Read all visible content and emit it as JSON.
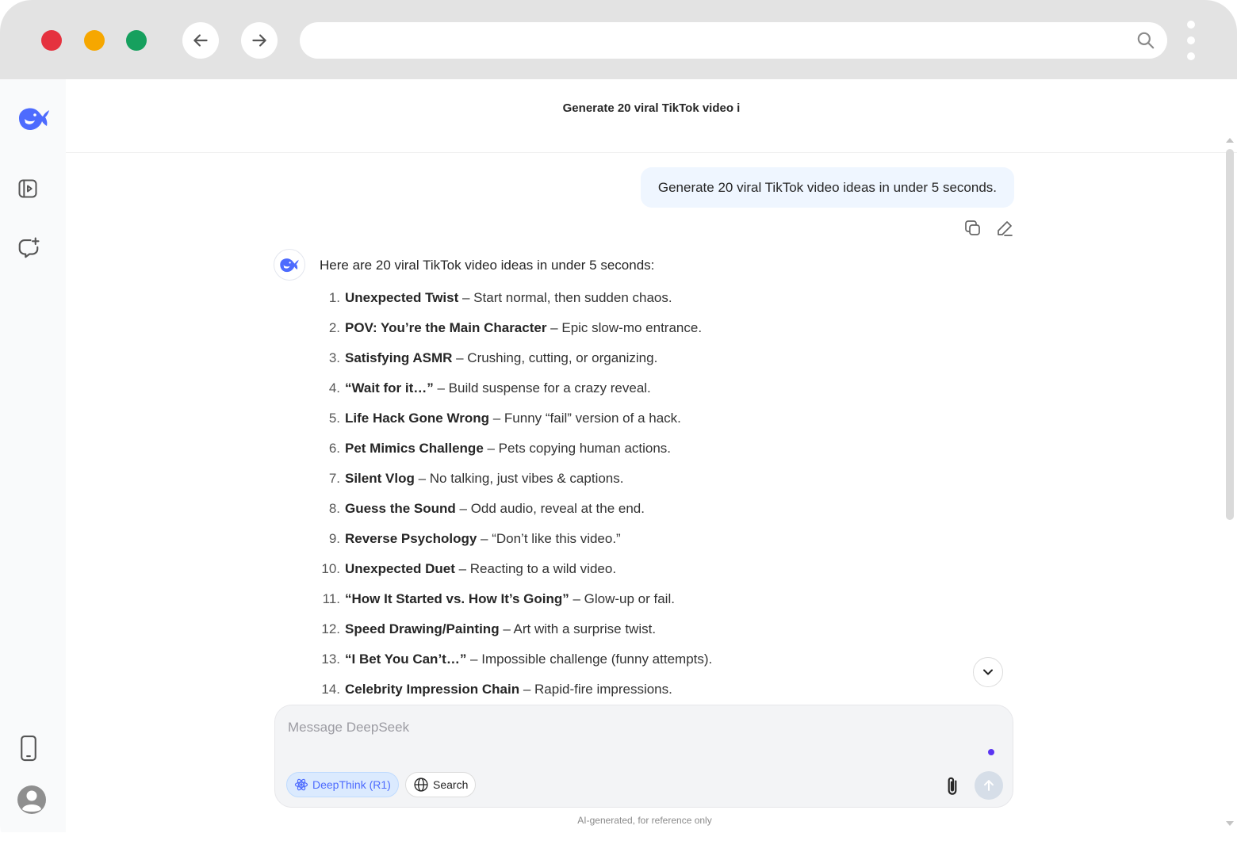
{
  "browser": {
    "traffic_lights": {
      "close": "#e5323f",
      "minimize": "#f6a700",
      "maximize": "#16a05e"
    },
    "back_icon": "arrow-left",
    "forward_icon": "arrow-right",
    "address_value": "",
    "search_icon": "magnifier",
    "menu_icon": "vertical-ellipsis"
  },
  "sidebar": {
    "logo_icon": "deepseek-whale-logo",
    "open_panel_icon": "sidebar-toggle",
    "new_chat_icon": "new-chat-bubble",
    "get_app_icon": "mobile-phone",
    "profile_icon": "user-avatar",
    "accent": "#4d6bfe"
  },
  "chat": {
    "title": "Generate 20 viral TikTok video i",
    "user_message": "Generate 20 viral TikTok video ideas in under 5 seconds.",
    "user_actions": {
      "copy_icon": "copy",
      "edit_icon": "pencil"
    },
    "assistant_intro": "Here are 20 viral TikTok video ideas in under 5 seconds:",
    "ideas": [
      {
        "num": "1.",
        "title": "Unexpected Twist",
        "desc": " – Start normal, then sudden chaos."
      },
      {
        "num": "2.",
        "title": "POV: You’re the Main Character",
        "desc": " – Epic slow-mo entrance."
      },
      {
        "num": "3.",
        "title": "Satisfying ASMR",
        "desc": " – Crushing, cutting, or organizing."
      },
      {
        "num": "4.",
        "title": "“Wait for it…”",
        "desc": " – Build suspense for a crazy reveal."
      },
      {
        "num": "5.",
        "title": "Life Hack Gone Wrong",
        "desc": " – Funny “fail” version of a hack."
      },
      {
        "num": "6.",
        "title": "Pet Mimics Challenge",
        "desc": " – Pets copying human actions."
      },
      {
        "num": "7.",
        "title": "Silent Vlog",
        "desc": " – No talking, just vibes & captions."
      },
      {
        "num": "8.",
        "title": "Guess the Sound",
        "desc": " – Odd audio, reveal at the end."
      },
      {
        "num": "9.",
        "title": "Reverse Psychology",
        "desc": " – “Don’t like this video.”"
      },
      {
        "num": "10.",
        "title": "Unexpected Duet",
        "desc": " – Reacting to a wild video."
      },
      {
        "num": "11.",
        "title": "“How It Started vs. How It’s Going”",
        "desc": " – Glow-up or fail."
      },
      {
        "num": "12.",
        "title": "Speed Drawing/Painting",
        "desc": " – Art with a surprise twist."
      },
      {
        "num": "13.",
        "title": "“I Bet You Can’t…”",
        "desc": " – Impossible challenge (funny attempts)."
      },
      {
        "num": "14.",
        "title": "Celebrity Impression Chain",
        "desc": " – Rapid-fire impressions."
      }
    ],
    "scroll_down_icon": "chevron-down"
  },
  "composer": {
    "placeholder": "Message DeepSeek",
    "deepthink_label": "DeepThink (R1)",
    "search_label": "Search",
    "attach_icon": "paperclip",
    "send_icon": "arrow-up"
  },
  "footer": {
    "disclaimer": "AI-generated, for reference only"
  }
}
